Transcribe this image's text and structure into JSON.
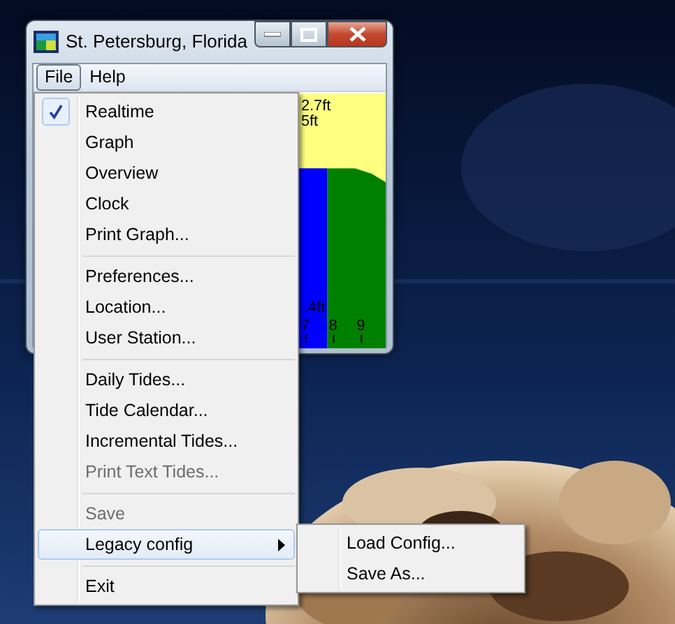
{
  "window": {
    "title": "St. Petersburg, Florida"
  },
  "menubar": [
    {
      "label": "File",
      "selected": true
    },
    {
      "label": "Help",
      "selected": false
    }
  ],
  "chart": {
    "top_labels": [
      "2.7ft",
      "5ft"
    ],
    "bottom_label": ".4ft",
    "hours": [
      "7",
      "8",
      "9"
    ]
  },
  "file_menu": [
    {
      "kind": "item",
      "label": "Realtime",
      "checked": true,
      "disabled": false,
      "selected": false,
      "has_submenu": false
    },
    {
      "kind": "item",
      "label": "Graph",
      "checked": false,
      "disabled": false,
      "selected": false,
      "has_submenu": false
    },
    {
      "kind": "item",
      "label": "Overview",
      "checked": false,
      "disabled": false,
      "selected": false,
      "has_submenu": false
    },
    {
      "kind": "item",
      "label": "Clock",
      "checked": false,
      "disabled": false,
      "selected": false,
      "has_submenu": false
    },
    {
      "kind": "item",
      "label": "Print Graph...",
      "checked": false,
      "disabled": false,
      "selected": false,
      "has_submenu": false
    },
    {
      "kind": "separator"
    },
    {
      "kind": "item",
      "label": "Preferences...",
      "checked": false,
      "disabled": false,
      "selected": false,
      "has_submenu": false
    },
    {
      "kind": "item",
      "label": "Location...",
      "checked": false,
      "disabled": false,
      "selected": false,
      "has_submenu": false
    },
    {
      "kind": "item",
      "label": "User Station...",
      "checked": false,
      "disabled": false,
      "selected": false,
      "has_submenu": false
    },
    {
      "kind": "separator"
    },
    {
      "kind": "item",
      "label": "Daily Tides...",
      "checked": false,
      "disabled": false,
      "selected": false,
      "has_submenu": false
    },
    {
      "kind": "item",
      "label": "Tide Calendar...",
      "checked": false,
      "disabled": false,
      "selected": false,
      "has_submenu": false
    },
    {
      "kind": "item",
      "label": "Incremental Tides...",
      "checked": false,
      "disabled": false,
      "selected": false,
      "has_submenu": false
    },
    {
      "kind": "item",
      "label": "Print Text Tides...",
      "checked": false,
      "disabled": true,
      "selected": false,
      "has_submenu": false
    },
    {
      "kind": "separator"
    },
    {
      "kind": "item",
      "label": "Save",
      "checked": false,
      "disabled": true,
      "selected": false,
      "has_submenu": false
    },
    {
      "kind": "item",
      "label": "Legacy config",
      "checked": false,
      "disabled": false,
      "selected": true,
      "has_submenu": true
    },
    {
      "kind": "separator"
    },
    {
      "kind": "item",
      "label": "Exit",
      "checked": false,
      "disabled": false,
      "selected": false,
      "has_submenu": false
    }
  ],
  "submenu": [
    {
      "label": "Load Config..."
    },
    {
      "label": "Save As..."
    }
  ]
}
